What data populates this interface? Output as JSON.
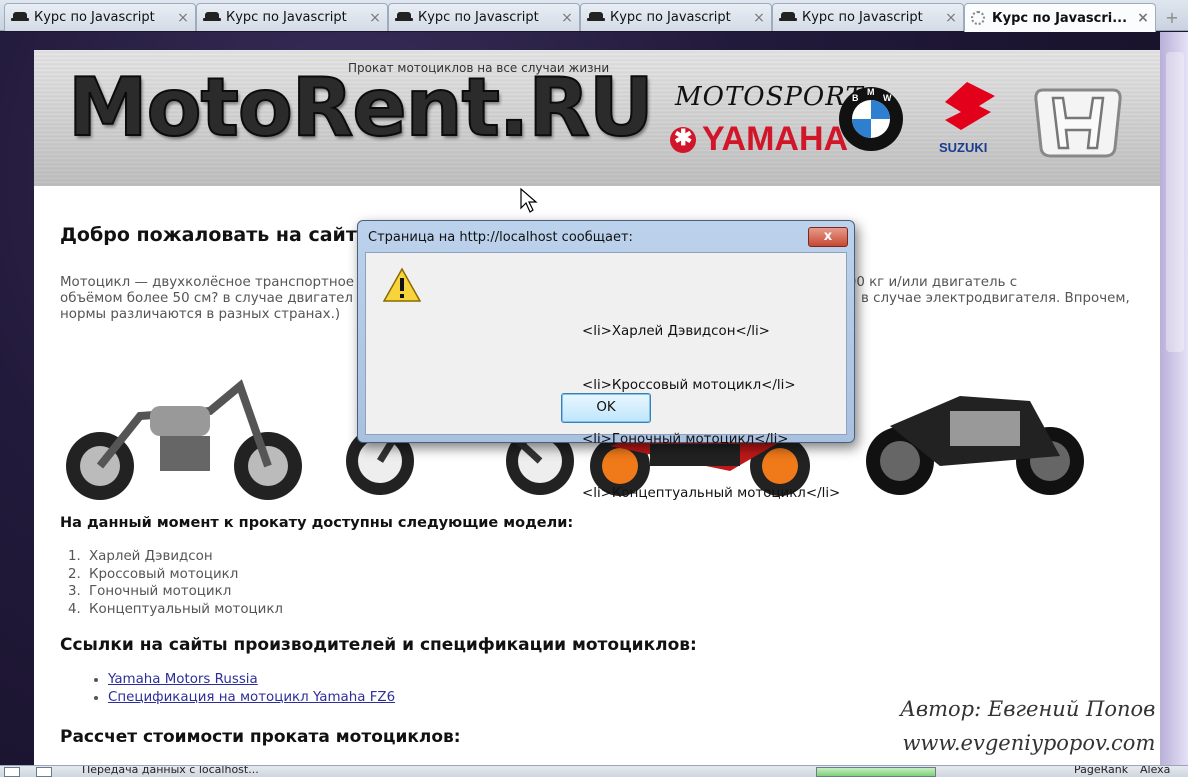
{
  "browser": {
    "tabs": [
      {
        "title": "Курс по Javascript",
        "close": "×"
      },
      {
        "title": "Курс по Javascript",
        "close": "×"
      },
      {
        "title": "Курс по Javascript",
        "close": "×"
      },
      {
        "title": "Курс по Javascript",
        "close": "×"
      },
      {
        "title": "Курс по Javascript",
        "close": "×"
      },
      {
        "title": "Курс по Javascri...",
        "close": "×",
        "active": true,
        "loading": true
      }
    ],
    "new_tab": "+",
    "status": {
      "text": "Передача данных с localhost...",
      "pagerank_label": "PageRank",
      "alexa_label": "Alexa"
    }
  },
  "site": {
    "tagline": "Прокат мотоциклов на все случаи жизни",
    "logo": "MotoRent.RU",
    "brands": {
      "motosport": "MOTOSPORT",
      "yamaha": "YAMAHA",
      "suzuki": "SUZUKI",
      "bmw_letters": [
        "B",
        "M",
        "W"
      ]
    },
    "welcome": "Добро пожаловать на сайт к",
    "intro": "Мотоцикл — двухколёсное транспортное средство с массой не более 400 кг и/или двигатель с объёмом более 50 см? в случае двигателя внутреннего сгорания или мощностью более 4 кВт в случае электродвигателя. Впрочем, нормы различаются в разных странах.)",
    "intro_left_1": "Мотоцикл — двухколёсное транспортное",
    "intro_left_2": "объёмом более 50 см? в случае двигател",
    "intro_left_3": "нормы различаются в разных странах.)",
    "intro_right_1": "е более 400 кг и/или двигатель с",
    "intro_right_2": "в случае электродвигателя. Впрочем,",
    "models_heading": "На данный момент к прокату доступны следующие модели:",
    "models": [
      "Харлей Дэвидсон",
      "Кроссовый мотоцикл",
      "Гоночный мотоцикл",
      "Концептуальный мотоцикл"
    ],
    "links_heading": "Ссылки на сайты производителей и спецификации мотоциклов:",
    "links": [
      "Yamaha Motors Russia",
      "Спецификация на мотоцикл Yamaha FZ6"
    ],
    "calc_heading": "Рассчет стоимости проката мотоциклов:",
    "author_line1": "Автор: Евгений Попов",
    "author_line2": "www.evgeniypopov.com"
  },
  "dialog": {
    "title": "Страница на http://localhost сообщает:",
    "close": "x",
    "lines": [
      "<li>Харлей Дэвидсон</li>",
      "<li>Кроссовый мотоцикл</li>",
      "<li>Гоночный мотоцикл</li>",
      "<li>Концептуальный мотоцикл</li>"
    ],
    "ok": "OK"
  },
  "colors": {
    "dialog_title_bg": "#bcd2ec",
    "close_red": "#c54a33",
    "link": "#2d2e9a",
    "yamaha_red": "#d1162a",
    "suzuki_red": "#e3001b"
  }
}
